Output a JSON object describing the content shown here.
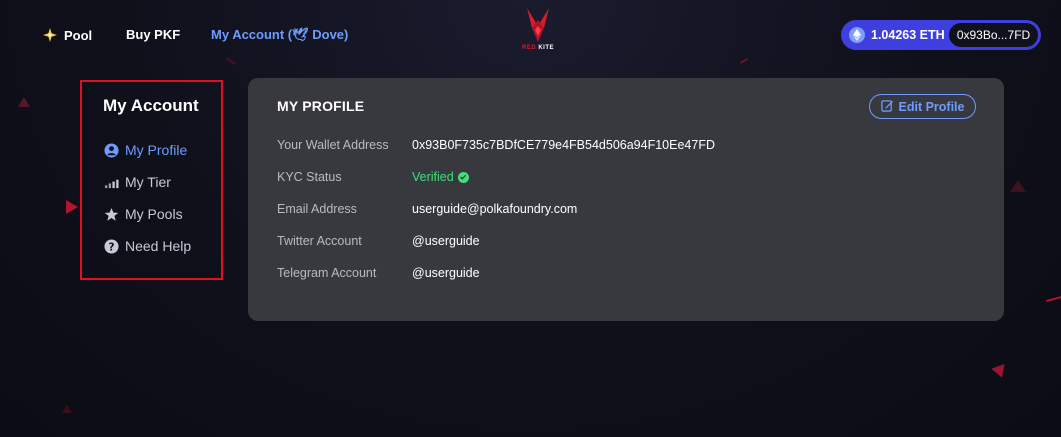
{
  "nav": {
    "pool_label": "Pool",
    "buy_label": "Buy PKF",
    "account_label": "My Account (🕊 Dove)"
  },
  "logo": {
    "text_red": "RED",
    "text_white": "KITE"
  },
  "wallet": {
    "balance": "1.04263 ETH",
    "address": "0x93Bo...7FD"
  },
  "sidebar": {
    "title": "My Account",
    "items": [
      {
        "label": "My Profile",
        "icon": "user-circle-icon",
        "active": true
      },
      {
        "label": "My Tier",
        "icon": "signal-bars-icon",
        "active": false
      },
      {
        "label": "My Pools",
        "icon": "star-icon",
        "active": false
      },
      {
        "label": "Need Help",
        "icon": "question-circle-icon",
        "active": false
      }
    ]
  },
  "profile": {
    "title": "MY PROFILE",
    "edit_label": "Edit Profile",
    "rows": [
      {
        "label": "Your Wallet Address",
        "value": "0x93B0F735c7BDfCE779e4FB54d506a94F10Ee47FD"
      },
      {
        "label": "KYC Status",
        "value": "Verified"
      },
      {
        "label": "Email Address",
        "value": "userguide@polkafoundry.com"
      },
      {
        "label": "Twitter Account",
        "value": "@userguide"
      },
      {
        "label": "Telegram Account",
        "value": "@userguide"
      }
    ]
  },
  "colors": {
    "accent": "#6f9bff",
    "wallet_bg": "#3f3fe0",
    "verified": "#3ee07a",
    "highlight_border": "#e0101e",
    "card_bg": "#38393f"
  }
}
